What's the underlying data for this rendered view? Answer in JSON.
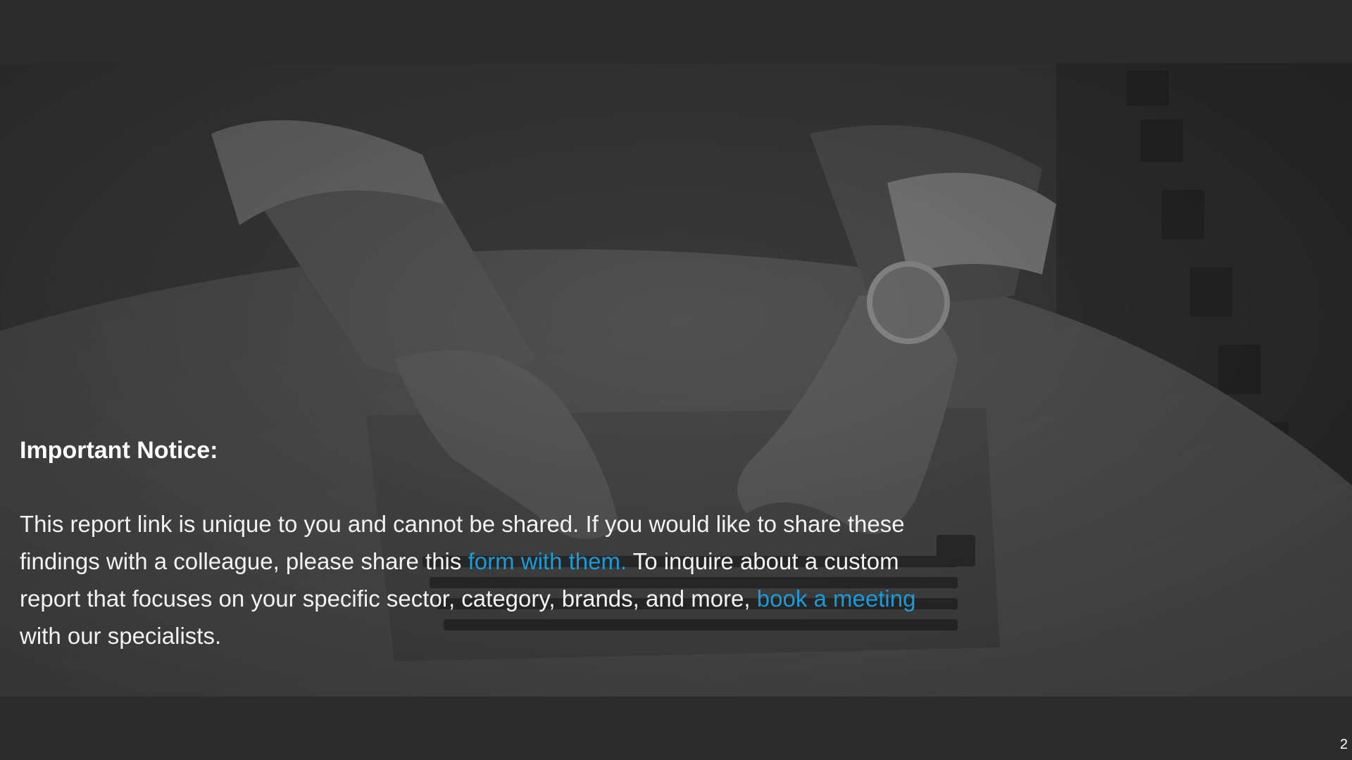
{
  "notice": {
    "title": "Important Notice:",
    "body_part1": "This report link is unique to you and cannot be shared. If you would like to share these findings with a colleague, please share this ",
    "link1_text": "form with them.",
    "body_part2": " To inquire about a custom report that focuses on your specific sector, category, brands, and more, ",
    "link2_text": "book a meeting",
    "body_part3": " with our specialists."
  },
  "page_number": "2",
  "colors": {
    "background": "#2b2b2b",
    "link": "#1a9ad6",
    "text": "#ffffff"
  }
}
